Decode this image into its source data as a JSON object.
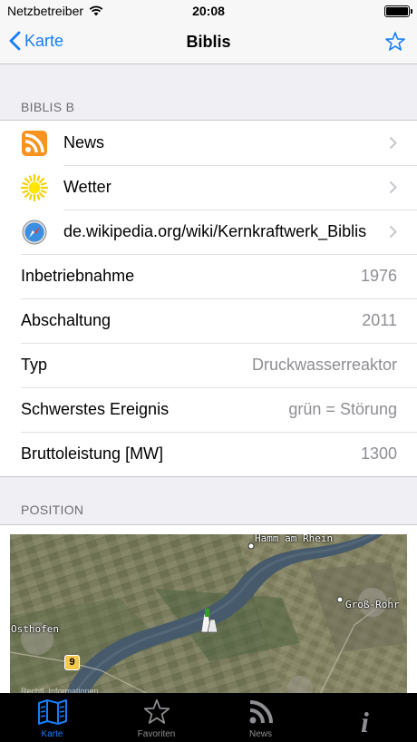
{
  "status_bar": {
    "carrier": "Netzbetreiber",
    "time": "20:08"
  },
  "nav": {
    "back_label": "Karte",
    "title": "Biblis",
    "favorite_icon": "star-outline-icon"
  },
  "section_info": {
    "header": "BIBLIS B",
    "links": [
      {
        "icon": "rss-icon",
        "label": "News"
      },
      {
        "icon": "sun-icon",
        "label": "Wetter"
      },
      {
        "icon": "safari-compass-icon",
        "label": "de.wikipedia.org/wiki/Kernkraftwerk_Biblis"
      }
    ],
    "details": [
      {
        "label": "Inbetriebnahme",
        "value": "1976"
      },
      {
        "label": "Abschaltung",
        "value": "2011"
      },
      {
        "label": "Typ",
        "value": "Druckwasserreaktor"
      },
      {
        "label": "Schwerstes Ereignis",
        "value": "grün = Störung"
      },
      {
        "label": "Bruttoleistung [MW]",
        "value": "1300"
      }
    ]
  },
  "section_position": {
    "header": "POSITION",
    "map": {
      "labels": [
        "Hamm am Rhein",
        "Groß-Rohr",
        "Osthofen"
      ],
      "road_shield": "9",
      "legal": "Rechtl. Informationen"
    }
  },
  "tabbar": {
    "tabs": [
      {
        "label": "Karte",
        "active": true
      },
      {
        "label": "Favoriten",
        "active": false
      },
      {
        "label": "News",
        "active": false
      },
      {
        "label": "",
        "active": false
      }
    ]
  },
  "colors": {
    "accent": "#157efb",
    "group_bg": "#efeff4",
    "secondary_text": "#8e8e93",
    "rss": "#f7931e",
    "plant_marker": "#3a9d23"
  }
}
